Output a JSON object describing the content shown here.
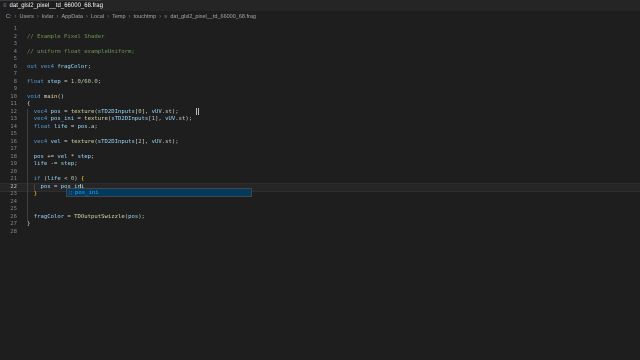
{
  "tab": {
    "label": "dat_glsl2_pixel__td_66000_68.frag",
    "icon": "file-type-icon"
  },
  "breadcrumb": {
    "parts": [
      "C:",
      "Users",
      "kvlar",
      "AppData",
      "Local",
      "Temp",
      "touchtmp"
    ],
    "file": "dat_glsl2_pixel__td_66000_68.frag"
  },
  "editor": {
    "current_line": 22,
    "lines": [
      {
        "n": "1",
        "tokens": []
      },
      {
        "n": "2",
        "tokens": [
          {
            "c": "cm",
            "t": "// Example Pixel Shader"
          }
        ]
      },
      {
        "n": "3",
        "tokens": []
      },
      {
        "n": "4",
        "tokens": [
          {
            "c": "cm",
            "t": "// uniform float exampleUniform;"
          }
        ]
      },
      {
        "n": "5",
        "tokens": []
      },
      {
        "n": "6",
        "tokens": [
          {
            "c": "kw",
            "t": "out vec4 "
          },
          {
            "c": "id",
            "t": "fragColor"
          },
          {
            "c": "tx",
            "t": ";"
          }
        ]
      },
      {
        "n": "7",
        "tokens": []
      },
      {
        "n": "8",
        "tokens": [
          {
            "c": "kw",
            "t": "float "
          },
          {
            "c": "id",
            "t": "step"
          },
          {
            "c": "tx",
            "t": " = "
          },
          {
            "c": "num",
            "t": "1.0"
          },
          {
            "c": "tx",
            "t": "/"
          },
          {
            "c": "num",
            "t": "60.0"
          },
          {
            "c": "tx",
            "t": ";"
          }
        ]
      },
      {
        "n": "9",
        "tokens": []
      },
      {
        "n": "10",
        "tokens": [
          {
            "c": "kw",
            "t": "void "
          },
          {
            "c": "fn",
            "t": "main"
          },
          {
            "c": "tx",
            "t": "()"
          }
        ]
      },
      {
        "n": "11",
        "tokens": [
          {
            "c": "tx",
            "t": "{"
          }
        ]
      },
      {
        "n": "12",
        "tokens": [
          {
            "c": "tx",
            "t": "  "
          },
          {
            "c": "kw",
            "t": "vec4 "
          },
          {
            "c": "id",
            "t": "pos"
          },
          {
            "c": "tx",
            "t": " = "
          },
          {
            "c": "fn",
            "t": "texture"
          },
          {
            "c": "tx",
            "t": "("
          },
          {
            "c": "id",
            "t": "sTD2DInputs"
          },
          {
            "c": "tx",
            "t": "["
          },
          {
            "c": "num",
            "t": "0"
          },
          {
            "c": "tx",
            "t": "], "
          },
          {
            "c": "id",
            "t": "vUV"
          },
          {
            "c": "tx",
            "t": ".st);"
          }
        ]
      },
      {
        "n": "13",
        "tokens": [
          {
            "c": "tx",
            "t": "  "
          },
          {
            "c": "kw",
            "t": "vec4 "
          },
          {
            "c": "id",
            "t": "pos_ini"
          },
          {
            "c": "tx",
            "t": " = "
          },
          {
            "c": "fn",
            "t": "texture"
          },
          {
            "c": "tx",
            "t": "("
          },
          {
            "c": "id",
            "t": "sTD2DInputs"
          },
          {
            "c": "tx",
            "t": "["
          },
          {
            "c": "num",
            "t": "1"
          },
          {
            "c": "tx",
            "t": "], "
          },
          {
            "c": "id",
            "t": "vUV"
          },
          {
            "c": "tx",
            "t": ".st);"
          }
        ]
      },
      {
        "n": "14",
        "tokens": [
          {
            "c": "tx",
            "t": "  "
          },
          {
            "c": "kw",
            "t": "float "
          },
          {
            "c": "id",
            "t": "life"
          },
          {
            "c": "tx",
            "t": " = "
          },
          {
            "c": "id",
            "t": "pos"
          },
          {
            "c": "tx",
            "t": ".a;"
          }
        ]
      },
      {
        "n": "15",
        "tokens": []
      },
      {
        "n": "16",
        "tokens": [
          {
            "c": "tx",
            "t": "  "
          },
          {
            "c": "kw",
            "t": "vec4 "
          },
          {
            "c": "id",
            "t": "vel"
          },
          {
            "c": "tx",
            "t": " = "
          },
          {
            "c": "fn",
            "t": "texture"
          },
          {
            "c": "tx",
            "t": "("
          },
          {
            "c": "id",
            "t": "sTD2DInputs"
          },
          {
            "c": "tx",
            "t": "["
          },
          {
            "c": "num",
            "t": "2"
          },
          {
            "c": "tx",
            "t": "], "
          },
          {
            "c": "id",
            "t": "vUV"
          },
          {
            "c": "tx",
            "t": ".st);"
          }
        ]
      },
      {
        "n": "17",
        "tokens": []
      },
      {
        "n": "18",
        "tokens": [
          {
            "c": "tx",
            "t": "  "
          },
          {
            "c": "id",
            "t": "pos"
          },
          {
            "c": "tx",
            "t": " += "
          },
          {
            "c": "id",
            "t": "vel"
          },
          {
            "c": "tx",
            "t": " * "
          },
          {
            "c": "id",
            "t": "step"
          },
          {
            "c": "tx",
            "t": ";"
          }
        ]
      },
      {
        "n": "19",
        "tokens": [
          {
            "c": "tx",
            "t": "  "
          },
          {
            "c": "id",
            "t": "life"
          },
          {
            "c": "tx",
            "t": " -= "
          },
          {
            "c": "id",
            "t": "step"
          },
          {
            "c": "tx",
            "t": ";"
          }
        ]
      },
      {
        "n": "20",
        "tokens": []
      },
      {
        "n": "21",
        "tokens": [
          {
            "c": "tx",
            "t": "  "
          },
          {
            "c": "kw",
            "t": "if "
          },
          {
            "c": "tx",
            "t": "("
          },
          {
            "c": "id",
            "t": "life"
          },
          {
            "c": "tx",
            "t": " < "
          },
          {
            "c": "num",
            "t": "0"
          },
          {
            "c": "tx",
            "t": ") "
          },
          {
            "c": "br",
            "t": "{"
          }
        ]
      },
      {
        "n": "22",
        "tokens": [
          {
            "c": "tx",
            "t": "    "
          },
          {
            "c": "id",
            "t": "pos"
          },
          {
            "c": "tx",
            "t": " = "
          },
          {
            "c": "id",
            "t": "pos_ini"
          }
        ]
      },
      {
        "n": "23",
        "tokens": [
          {
            "c": "tx",
            "t": "  "
          },
          {
            "c": "br",
            "t": "}"
          }
        ]
      },
      {
        "n": "24",
        "tokens": []
      },
      {
        "n": "25",
        "tokens": []
      },
      {
        "n": "26",
        "tokens": [
          {
            "c": "tx",
            "t": "  "
          },
          {
            "c": "id",
            "t": "fragColor"
          },
          {
            "c": "tx",
            "t": " = "
          },
          {
            "c": "fn",
            "t": "TDOutputSwizzle"
          },
          {
            "c": "tx",
            "t": "("
          },
          {
            "c": "id",
            "t": "pos"
          },
          {
            "c": "tx",
            "t": ");"
          }
        ]
      },
      {
        "n": "27",
        "tokens": [
          {
            "c": "tx",
            "t": "}"
          }
        ]
      },
      {
        "n": "28",
        "tokens": []
      }
    ]
  },
  "suggest": {
    "icon": "variable-icon",
    "match": "pos_ini",
    "rest": ""
  },
  "colors": {
    "background": "#1e1e1e",
    "comment": "#6a9955",
    "keyword": "#569cd6",
    "function": "#dcdcaa",
    "number": "#b5cea8",
    "identifier": "#9cdcfe",
    "suggest_selected": "#04395e"
  }
}
